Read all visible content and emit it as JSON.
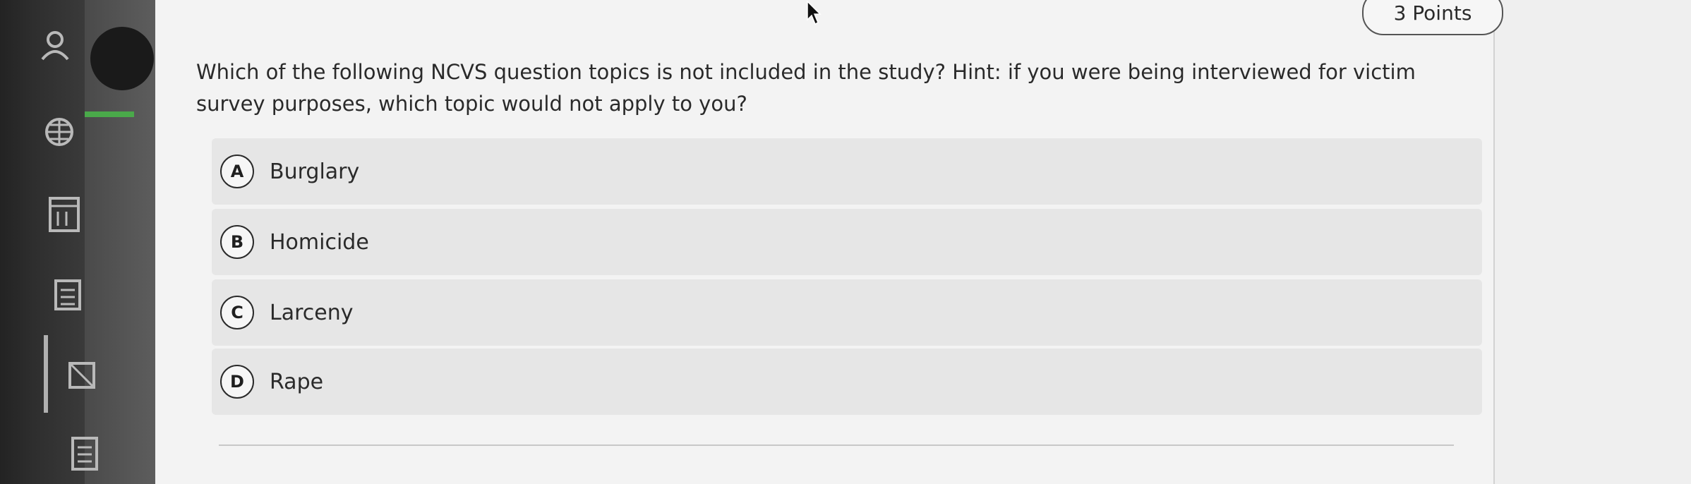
{
  "header": {
    "points_label": "3 Points"
  },
  "question": {
    "text": "Which of the following NCVS question topics is not included in the study? Hint: if you were being interviewed for victim survey purposes, which topic would not apply to you?"
  },
  "options": [
    {
      "letter": "A",
      "label": "Burglary"
    },
    {
      "letter": "B",
      "label": "Homicide"
    },
    {
      "letter": "C",
      "label": "Larceny"
    },
    {
      "letter": "D",
      "label": "Rape"
    }
  ],
  "icons": {
    "rail": [
      "user-icon",
      "globe-icon",
      "calendar-icon",
      "calculator-icon",
      "mail-icon",
      "document-icon"
    ],
    "cursor": "mouse-pointer-icon"
  },
  "colors": {
    "accent": "#4aa94a",
    "rail": "#2e2e2e"
  }
}
